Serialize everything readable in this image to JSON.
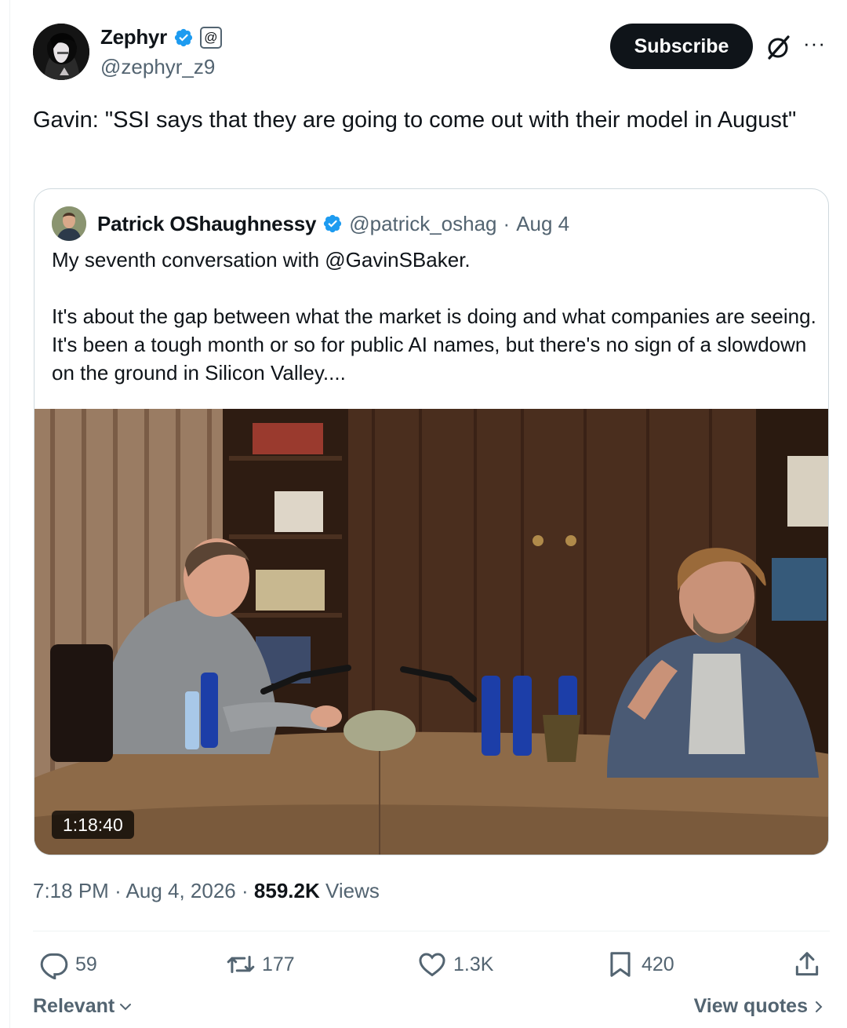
{
  "author": {
    "display_name": "Zephyr",
    "handle": "@zephyr_z9",
    "verified_icon": "verified-badge-icon",
    "affiliate_badge": "@"
  },
  "header": {
    "subscribe_label": "Subscribe",
    "grok_icon": "grok-icon",
    "more_icon": "more-options-icon"
  },
  "tweet": {
    "text": "Gavin: \"SSI says that they are going to come out with their model in August\""
  },
  "quote": {
    "author_name": "Patrick OShaughnessy",
    "handle": "@patrick_oshag",
    "separator": "·",
    "date": "Aug 4",
    "paragraph_1": "My seventh conversation with @GavinSBaker.",
    "paragraph_2": "It's about the gap between what the market is doing and what companies are seeing. It's been a tough month or so for public AI names, but there's no sign of a slowdown on the ground in Silicon Valley....",
    "video_duration": "1:18:40"
  },
  "meta": {
    "time": "7:18 PM",
    "separator": "·",
    "date": "Aug 4, 2026",
    "views_count": "859.2K",
    "views_label": "Views"
  },
  "actions": {
    "replies": "59",
    "reposts": "177",
    "likes": "1.3K",
    "bookmarks": "420"
  },
  "footer": {
    "sort_label": "Relevant",
    "view_quotes_label": "View quotes"
  },
  "colors": {
    "text_primary": "#0f1419",
    "text_secondary": "#536471",
    "verified_blue": "#1d9bf0",
    "border": "#cfd9de"
  }
}
